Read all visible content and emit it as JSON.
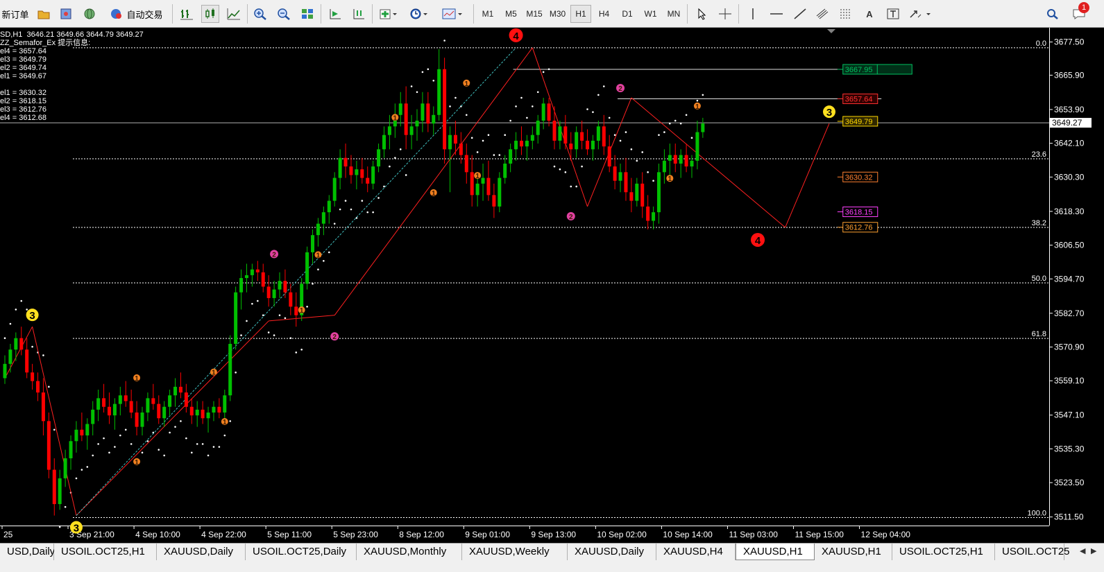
{
  "toolbar": {
    "new_order_label": "新订单",
    "auto_trading_label": "自动交易",
    "timeframes": [
      "M1",
      "M5",
      "M15",
      "M30",
      "H1",
      "H4",
      "D1",
      "W1",
      "MN"
    ],
    "active_timeframe": "H1",
    "notification_count": "1"
  },
  "chart": {
    "symbol_line": "SD,H1  3646.21 3649.66 3644.79 3649.27",
    "indicator_line": "ZZ_Semafor_Ex 提示信息:",
    "levels_top": [
      "el4 = 3657.64",
      "el3 = 3649.79",
      "el2 = 3649.74",
      "el1 = 3649.67"
    ],
    "levels_bottom": [
      "el1 = 3630.32",
      "el2 = 3618.15",
      "el3 = 3612.76",
      "el4 = 3612.68"
    ],
    "current_price": "3649.27",
    "colors": {
      "up": "#00c000",
      "down": "#ff0000",
      "bg": "#000000",
      "fg": "#ffffff",
      "dots": "#ffffff",
      "zigzag": "#ff2020"
    },
    "fib_levels": [
      {
        "label": "0.0",
        "price": 3675.5
      },
      {
        "label": "23.6",
        "price": 3636.7
      },
      {
        "label": "38.2",
        "price": 3612.7
      },
      {
        "label": "50.0",
        "price": 3593.3
      },
      {
        "label": "61.8",
        "price": 3573.9
      },
      {
        "label": "100.0",
        "price": 3511.3
      }
    ],
    "price_tags": [
      {
        "text": "3667.95",
        "price": 3667.95,
        "color": "#00c060",
        "bg": "#003018"
      },
      {
        "text": "3657.64",
        "price": 3657.64,
        "color": "#ff3030",
        "bg": "#300000"
      },
      {
        "text": "3649.79",
        "price": 3649.79,
        "color": "#ffd700",
        "bg": "#302800"
      },
      {
        "text": "3630.32",
        "price": 3630.32,
        "color": "#ff8030",
        "bg": "#000000"
      },
      {
        "text": "3618.15",
        "price": 3618.15,
        "color": "#ff40ff",
        "bg": "#000000"
      },
      {
        "text": "3612.76",
        "price": 3612.76,
        "color": "#ffa030",
        "bg": "#000000"
      }
    ]
  },
  "chart_data": {
    "type": "candlestick",
    "symbol": "XAUUSD",
    "timeframe": "H1",
    "y_ticks": [
      "3677.50",
      "3665.90",
      "3653.90",
      "3642.10",
      "3630.30",
      "3618.30",
      "3606.50",
      "3594.70",
      "3582.70",
      "3570.90",
      "3559.10",
      "3547.10",
      "3535.30",
      "3523.50",
      "3511.50"
    ],
    "y_range": [
      3508.5,
      3682.0
    ],
    "x_labels": [
      "25",
      "3 Sep 21:00",
      "4 Sep 10:00",
      "4 Sep 22:00",
      "5 Sep 11:00",
      "5 Sep 23:00",
      "8 Sep 12:00",
      "9 Sep 01:00",
      "9 Sep 13:00",
      "10 Sep 02:00",
      "10 Sep 14:00",
      "11 Sep 03:00",
      "11 Sep 15:00",
      "12 Sep 04:00"
    ],
    "x_labels_hours": [
      0,
      12,
      24,
      36,
      48,
      60,
      72,
      84,
      96,
      108,
      120,
      132,
      144,
      156
    ],
    "zigzag": [
      {
        "hour": 0,
        "price": 3560
      },
      {
        "hour": 5,
        "price": 3578
      },
      {
        "hour": 13,
        "price": 3512
      },
      {
        "hour": 48,
        "price": 3580
      },
      {
        "hour": 60,
        "price": 3582
      },
      {
        "hour": 96,
        "price": 3675.5
      },
      {
        "hour": 106,
        "price": 3620
      },
      {
        "hour": 114,
        "price": 3658
      },
      {
        "hour": 142,
        "price": 3612.7
      },
      {
        "hour": 150,
        "price": 3649
      }
    ],
    "semafor": [
      {
        "hour": 5,
        "price": 3578,
        "level": 3,
        "above": true
      },
      {
        "hour": 13,
        "price": 3512,
        "level": 3,
        "above": false
      },
      {
        "hour": 24,
        "price": 3557,
        "level": 1,
        "above": true
      },
      {
        "hour": 24,
        "price": 3534,
        "level": 1,
        "above": false
      },
      {
        "hour": 38,
        "price": 3559,
        "level": 1,
        "above": true
      },
      {
        "hour": 40,
        "price": 3548,
        "level": 1,
        "above": false
      },
      {
        "hour": 49,
        "price": 3600,
        "level": 2,
        "above": true
      },
      {
        "hour": 54,
        "price": 3587,
        "level": 1,
        "above": false
      },
      {
        "hour": 57,
        "price": 3600,
        "level": 1,
        "above": true
      },
      {
        "hour": 60,
        "price": 3578,
        "level": 2,
        "above": false
      },
      {
        "hour": 71,
        "price": 3648,
        "level": 1,
        "above": true
      },
      {
        "hour": 78,
        "price": 3628,
        "level": 1,
        "above": false
      },
      {
        "hour": 84,
        "price": 3660,
        "level": 1,
        "above": true
      },
      {
        "hour": 86,
        "price": 3634,
        "level": 1,
        "above": false
      },
      {
        "hour": 93,
        "price": 3675.5,
        "level": 4,
        "above": true
      },
      {
        "hour": 103,
        "price": 3620,
        "level": 2,
        "above": false
      },
      {
        "hour": 112,
        "price": 3658,
        "level": 2,
        "above": true
      },
      {
        "hour": 121,
        "price": 3633,
        "level": 1,
        "above": false
      },
      {
        "hour": 126,
        "price": 3652,
        "level": 1,
        "above": true
      },
      {
        "hour": 137,
        "price": 3612.7,
        "level": 4,
        "above": false
      },
      {
        "hour": 150,
        "price": 3649,
        "level": 3,
        "above": true
      }
    ],
    "candles": [
      [
        3560,
        3568,
        3558,
        3565
      ],
      [
        3565,
        3572,
        3562,
        3570
      ],
      [
        3570,
        3576,
        3566,
        3574
      ],
      [
        3574,
        3578,
        3568,
        3570
      ],
      [
        3570,
        3574,
        3560,
        3562
      ],
      [
        3562,
        3565,
        3556,
        3559
      ],
      [
        3559,
        3562,
        3552,
        3555
      ],
      [
        3555,
        3560,
        3540,
        3545
      ],
      [
        3545,
        3548,
        3525,
        3528
      ],
      [
        3528,
        3532,
        3512,
        3516
      ],
      [
        3516,
        3528,
        3514,
        3525
      ],
      [
        3525,
        3535,
        3522,
        3532
      ],
      [
        3532,
        3540,
        3528,
        3538
      ],
      [
        3538,
        3545,
        3534,
        3542
      ],
      [
        3542,
        3548,
        3538,
        3540
      ],
      [
        3540,
        3546,
        3535,
        3544
      ],
      [
        3544,
        3552,
        3540,
        3549
      ],
      [
        3549,
        3556,
        3545,
        3553
      ],
      [
        3553,
        3558,
        3548,
        3550
      ],
      [
        3550,
        3555,
        3544,
        3547
      ],
      [
        3547,
        3553,
        3542,
        3551
      ],
      [
        3551,
        3557,
        3547,
        3554
      ],
      [
        3554,
        3559,
        3550,
        3552
      ],
      [
        3552,
        3556,
        3546,
        3548
      ],
      [
        3548,
        3552,
        3540,
        3543
      ],
      [
        3543,
        3550,
        3540,
        3548
      ],
      [
        3548,
        3555,
        3545,
        3553
      ],
      [
        3553,
        3558,
        3549,
        3551
      ],
      [
        3551,
        3554,
        3544,
        3546
      ],
      [
        3546,
        3552,
        3543,
        3550
      ],
      [
        3550,
        3556,
        3547,
        3554
      ],
      [
        3554,
        3560,
        3550,
        3557
      ],
      [
        3557,
        3562,
        3553,
        3555
      ],
      [
        3555,
        3558,
        3548,
        3550
      ],
      [
        3550,
        3553,
        3544,
        3547
      ],
      [
        3547,
        3552,
        3543,
        3549
      ],
      [
        3549,
        3552,
        3544,
        3546
      ],
      [
        3546,
        3550,
        3541,
        3548
      ],
      [
        3548,
        3552,
        3545,
        3550
      ],
      [
        3550,
        3553,
        3546,
        3548
      ],
      [
        3548,
        3556,
        3546,
        3554
      ],
      [
        3554,
        3575,
        3552,
        3572
      ],
      [
        3572,
        3592,
        3570,
        3590
      ],
      [
        3590,
        3598,
        3584,
        3595
      ],
      [
        3595,
        3600,
        3590,
        3596
      ],
      [
        3596,
        3600,
        3592,
        3598
      ],
      [
        3598,
        3601,
        3594,
        3597
      ],
      [
        3597,
        3600,
        3590,
        3592
      ],
      [
        3592,
        3596,
        3585,
        3588
      ],
      [
        3588,
        3594,
        3585,
        3591
      ],
      [
        3591,
        3597,
        3588,
        3594
      ],
      [
        3594,
        3598,
        3588,
        3590
      ],
      [
        3590,
        3593,
        3582,
        3585
      ],
      [
        3585,
        3590,
        3578,
        3582
      ],
      [
        3582,
        3595,
        3580,
        3593
      ],
      [
        3593,
        3606,
        3591,
        3604
      ],
      [
        3604,
        3612,
        3600,
        3610
      ],
      [
        3610,
        3616,
        3606,
        3614
      ],
      [
        3614,
        3620,
        3610,
        3618
      ],
      [
        3618,
        3624,
        3614,
        3622
      ],
      [
        3622,
        3632,
        3620,
        3630
      ],
      [
        3630,
        3640,
        3626,
        3637
      ],
      [
        3637,
        3642,
        3630,
        3634
      ],
      [
        3634,
        3638,
        3628,
        3631
      ],
      [
        3631,
        3636,
        3626,
        3633
      ],
      [
        3633,
        3637,
        3628,
        3630
      ],
      [
        3630,
        3634,
        3625,
        3628
      ],
      [
        3628,
        3636,
        3626,
        3634
      ],
      [
        3634,
        3642,
        3632,
        3640
      ],
      [
        3640,
        3648,
        3637,
        3645
      ],
      [
        3645,
        3652,
        3640,
        3648
      ],
      [
        3648,
        3656,
        3644,
        3652
      ],
      [
        3652,
        3660,
        3648,
        3656
      ],
      [
        3656,
        3662,
        3640,
        3645
      ],
      [
        3645,
        3652,
        3640,
        3648
      ],
      [
        3648,
        3654,
        3643,
        3650
      ],
      [
        3650,
        3660,
        3646,
        3656
      ],
      [
        3656,
        3660,
        3646,
        3649
      ],
      [
        3649,
        3655,
        3645,
        3652
      ],
      [
        3652,
        3675,
        3650,
        3668
      ],
      [
        3668,
        3672,
        3635,
        3640
      ],
      [
        3640,
        3648,
        3625,
        3645
      ],
      [
        3645,
        3650,
        3638,
        3642
      ],
      [
        3642,
        3646,
        3635,
        3638
      ],
      [
        3638,
        3642,
        3628,
        3632
      ],
      [
        3632,
        3638,
        3620,
        3624
      ],
      [
        3624,
        3632,
        3620,
        3628
      ],
      [
        3628,
        3635,
        3622,
        3630
      ],
      [
        3630,
        3636,
        3622,
        3624
      ],
      [
        3624,
        3628,
        3616,
        3620
      ],
      [
        3620,
        3632,
        3618,
        3630
      ],
      [
        3630,
        3638,
        3628,
        3635
      ],
      [
        3635,
        3642,
        3632,
        3640
      ],
      [
        3640,
        3646,
        3636,
        3643
      ],
      [
        3643,
        3648,
        3638,
        3641
      ],
      [
        3641,
        3645,
        3636,
        3643
      ],
      [
        3643,
        3648,
        3640,
        3645
      ],
      [
        3645,
        3652,
        3642,
        3650
      ],
      [
        3650,
        3658,
        3647,
        3656
      ],
      [
        3656,
        3658,
        3648,
        3650
      ],
      [
        3650,
        3655,
        3640,
        3643
      ],
      [
        3643,
        3650,
        3640,
        3648
      ],
      [
        3648,
        3652,
        3640,
        3642
      ],
      [
        3642,
        3646,
        3636,
        3640
      ],
      [
        3640,
        3648,
        3637,
        3646
      ],
      [
        3646,
        3650,
        3640,
        3643
      ],
      [
        3643,
        3647,
        3638,
        3640
      ],
      [
        3640,
        3645,
        3636,
        3643
      ],
      [
        3643,
        3650,
        3640,
        3648
      ],
      [
        3648,
        3652,
        3638,
        3641
      ],
      [
        3641,
        3645,
        3632,
        3634
      ],
      [
        3634,
        3638,
        3626,
        3629
      ],
      [
        3629,
        3635,
        3625,
        3632
      ],
      [
        3632,
        3637,
        3622,
        3625
      ],
      [
        3625,
        3630,
        3618,
        3622
      ],
      [
        3622,
        3630,
        3620,
        3628
      ],
      [
        3628,
        3632,
        3616,
        3620
      ],
      [
        3620,
        3624,
        3612,
        3615
      ],
      [
        3615,
        3620,
        3612,
        3618
      ],
      [
        3618,
        3635,
        3614,
        3632
      ],
      [
        3632,
        3640,
        3628,
        3636
      ],
      [
        3636,
        3642,
        3630,
        3638
      ],
      [
        3638,
        3642,
        3632,
        3635
      ],
      [
        3635,
        3640,
        3630,
        3638
      ],
      [
        3638,
        3642,
        3632,
        3634
      ],
      [
        3634,
        3638,
        3630,
        3636
      ],
      [
        3636,
        3650,
        3633,
        3646
      ],
      [
        3646,
        3651,
        3644,
        3649
      ]
    ]
  },
  "tabs": {
    "items": [
      "USD,Daily",
      "USOIL.OCT25,H1",
      "XAUUSD,Daily",
      "USOIL.OCT25,Daily",
      "XAUUSD,Monthly",
      "XAUUSD,Weekly",
      "XAUUSD,Daily",
      "XAUUSD,H4",
      "XAUUSD,H1",
      "XAUUSD,H1",
      "USOIL.OCT25,H1",
      "USOIL.OCT25"
    ],
    "active_index": 8,
    "prev_label": "◀",
    "next_label": "▶"
  }
}
